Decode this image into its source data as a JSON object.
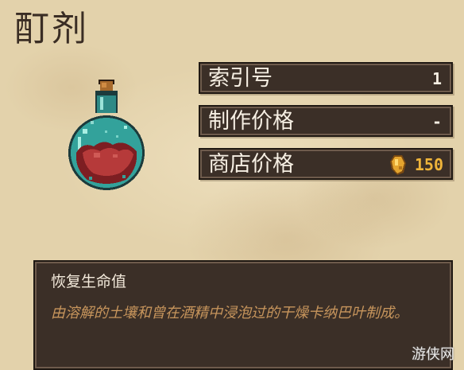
{
  "item": {
    "name": "酊剂",
    "icon": "potion-flask-icon"
  },
  "stats": {
    "index": {
      "label": "索引号",
      "value": "1"
    },
    "craft_price": {
      "label": "制作价格",
      "value": "-"
    },
    "shop_price": {
      "label": "商店价格",
      "value": "150",
      "currency_icon": "gold-coin-icon"
    }
  },
  "description": {
    "title": "恢复生命值",
    "body": "由溶解的土壤和曾在酒精中浸泡过的干燥卡纳巴叶制成。"
  },
  "watermark": "游侠网",
  "colors": {
    "panel": "#3b2f27",
    "panel_text": "#f6efe3",
    "gold": "#f0b53a",
    "flavor_text": "#c7955c",
    "background": "#e3d2ab"
  }
}
